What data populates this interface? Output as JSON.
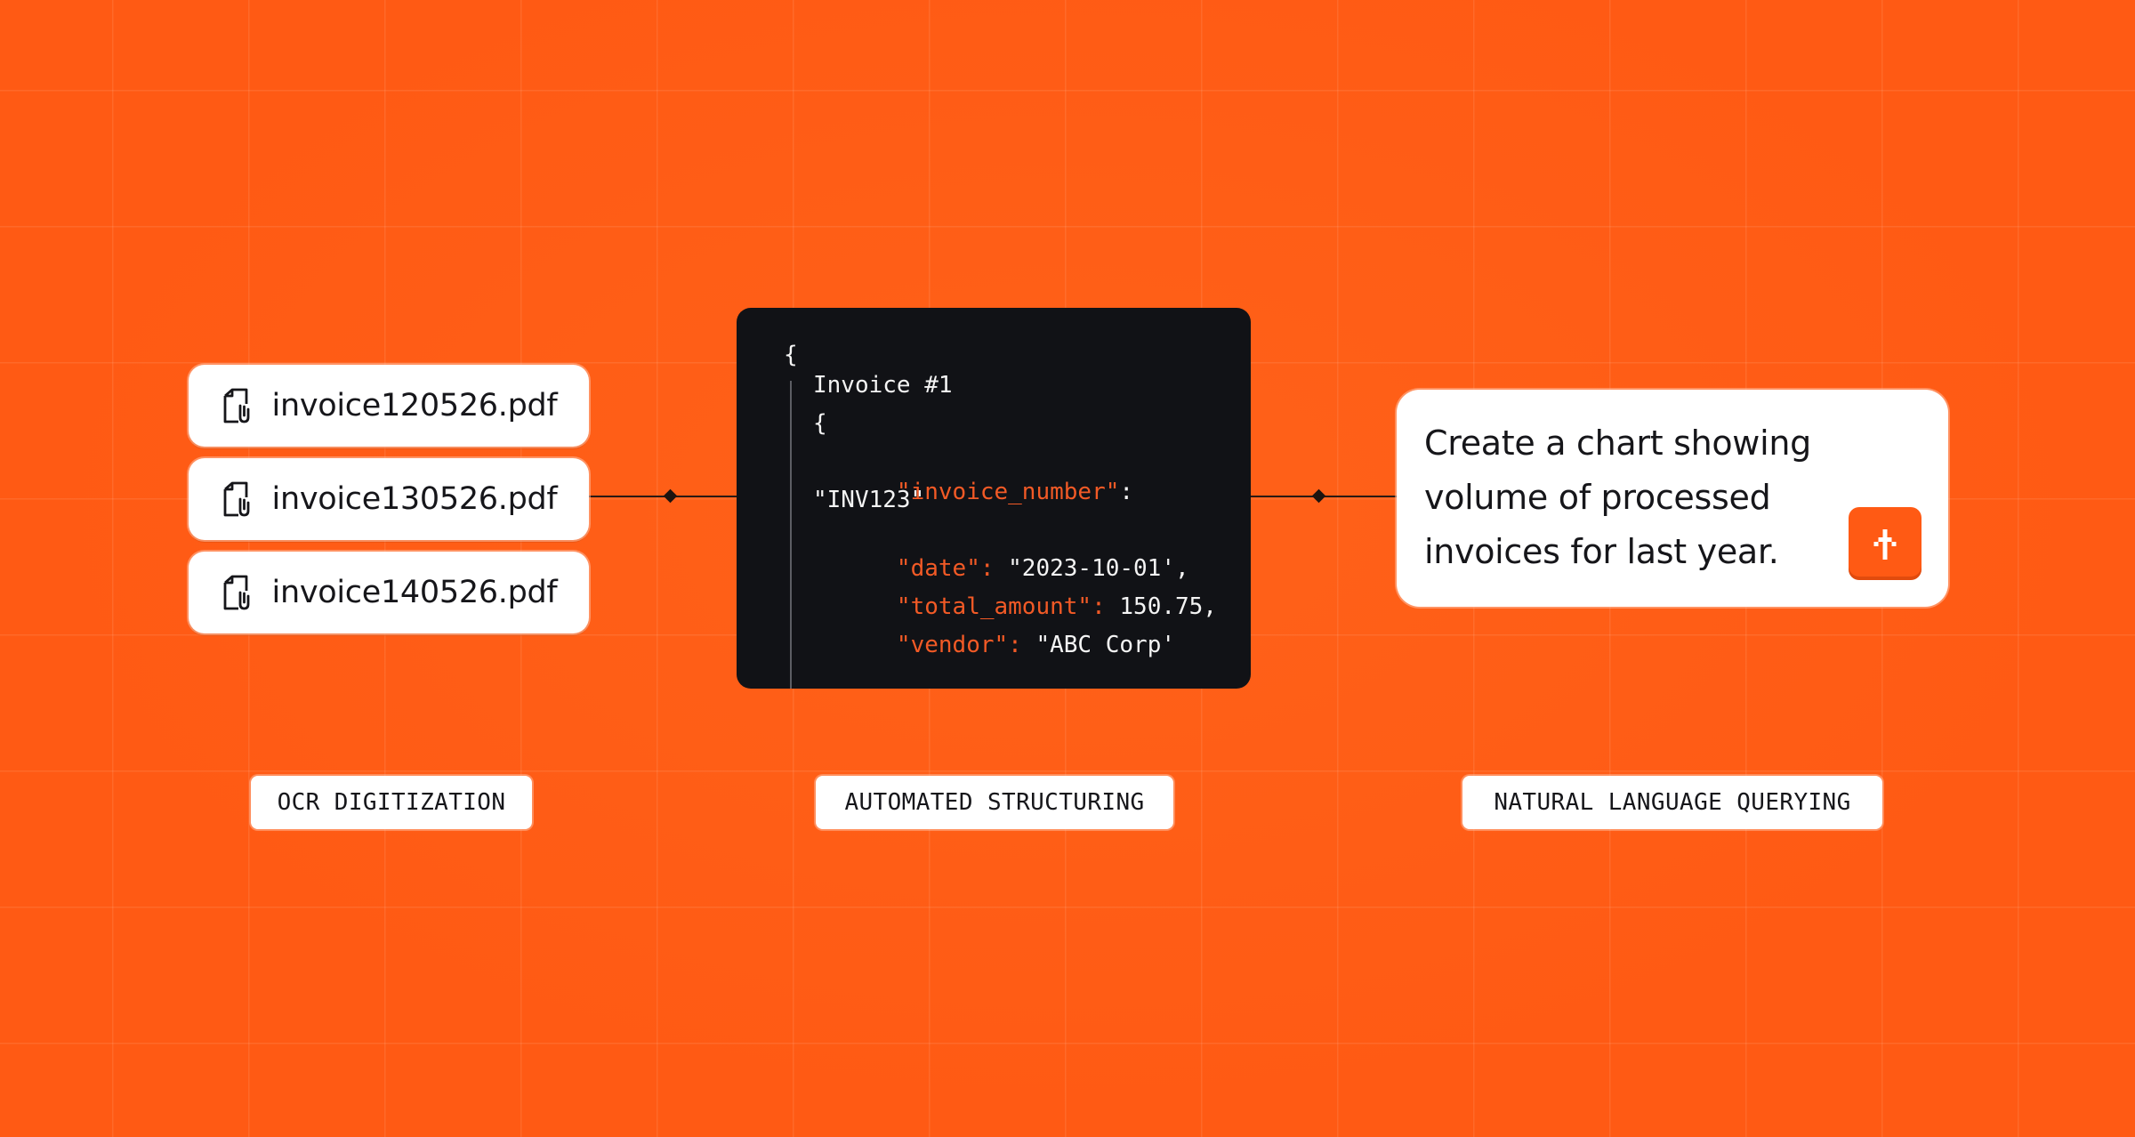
{
  "files": [
    {
      "name": "invoice120526.pdf",
      "icon": "pdf-file-icon"
    },
    {
      "name": "invoice130526.pdf",
      "icon": "pdf-file-icon"
    },
    {
      "name": "invoice140526.pdf",
      "icon": "pdf-file-icon"
    }
  ],
  "code": {
    "open_brace": "{",
    "title": "Invoice #1",
    "inner_brace": "{",
    "invoice_number_key": "\"invoice_number\"",
    "colon": ":",
    "invoice_number_value": "\"INV123\"",
    "date_key": "\"date\":",
    "date_value": " \"2023-10-01',",
    "total_amount_key": "\"total_amount\":",
    "total_amount_value": " 150.75,",
    "vendor_key": "\"vendor\":",
    "vendor_value": " \"ABC Corp'"
  },
  "query": {
    "text": "Create a chart showing volume of processed invoices for last year.",
    "send_icon": "arrow-up-icon"
  },
  "stages": {
    "ocr": "OCR DIGITIZATION",
    "structuring": "AUTOMATED STRUCTURING",
    "querying": "NATURAL LANGUAGE QUERYING"
  },
  "colors": {
    "background": "#FF5A14",
    "code_panel": "#111216",
    "code_key": "#F25A26",
    "code_text": "#F4F4F4",
    "card": "#FFFFFF",
    "text": "#16161A"
  }
}
